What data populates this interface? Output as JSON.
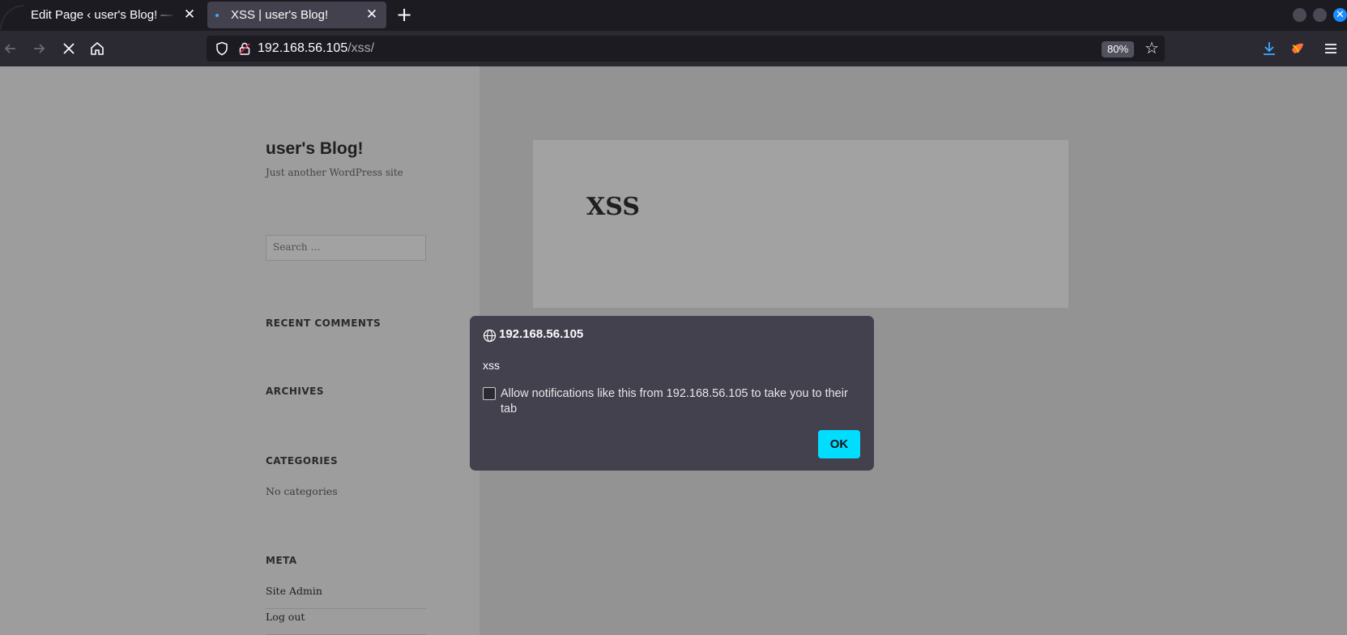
{
  "browser": {
    "tabs": [
      {
        "title": "Edit Page ‹ user's Blog! — WordPress",
        "active": false
      },
      {
        "title": "XSS | user's Blog!",
        "active": true
      }
    ],
    "tab_close_glyph": "✕",
    "new_tab_glyph": "+",
    "url": {
      "host": "192.168.56.105",
      "path": "/xss/"
    },
    "zoom": "80%",
    "icons": [
      "back-icon",
      "forward-icon",
      "stop-icon",
      "home-icon",
      "shield-icon",
      "lock-icon",
      "star-icon",
      "download-icon",
      "extension-icon",
      "menu-icon"
    ],
    "accent_color": "#00ddff"
  },
  "site": {
    "title": "user's Blog!",
    "description": "Just another WordPress site",
    "search_placeholder": "Search …",
    "widgets": {
      "recent_comments": "RECENT COMMENTS",
      "archives": "ARCHIVES",
      "categories": "CATEGORIES",
      "categories_empty": "No categories",
      "meta": "META",
      "meta_links": [
        "Site Admin",
        "Log out"
      ]
    },
    "article_title": "XSS"
  },
  "dialog": {
    "host": "192.168.56.105",
    "message": "xss",
    "checkbox_label": "Allow notifications like this from 192.168.56.105 to take you to their tab",
    "checkbox_checked": false,
    "ok_label": "OK"
  }
}
